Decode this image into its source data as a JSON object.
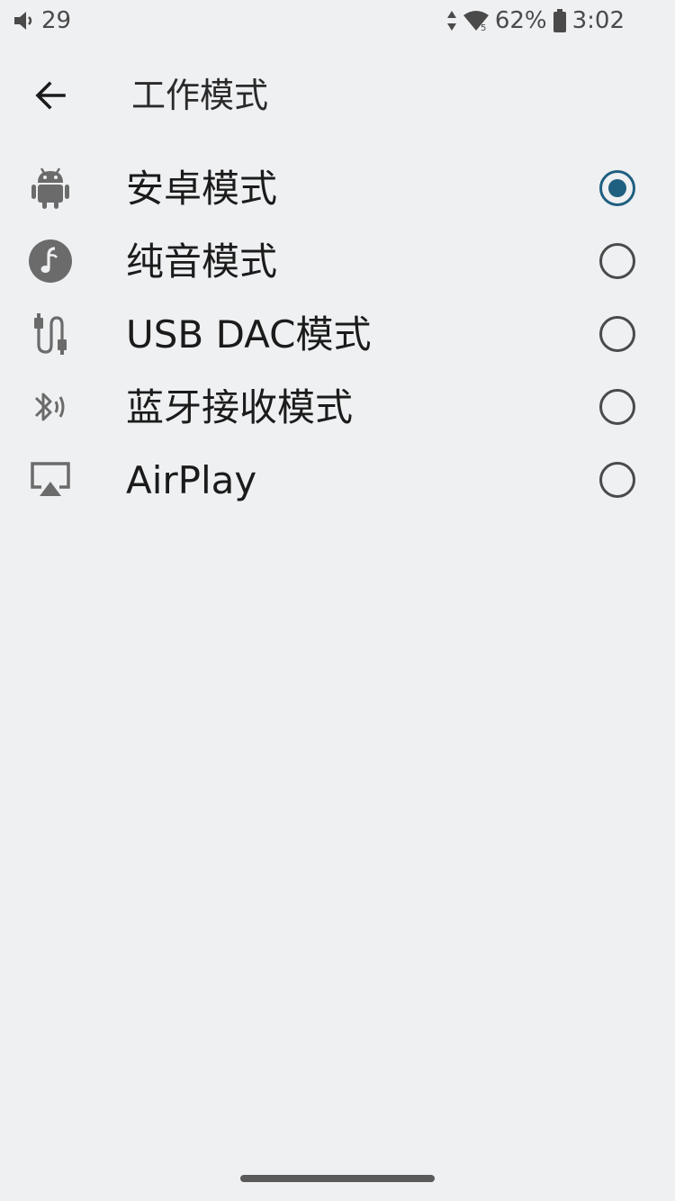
{
  "status_bar": {
    "volume": "29",
    "battery_percent": "62%",
    "time": "3:02",
    "icons": [
      "volume-icon",
      "data-arrows-icon",
      "wifi-icon",
      "battery-icon"
    ]
  },
  "header": {
    "title": "工作模式",
    "back_icon": "arrow-left-icon"
  },
  "modes": [
    {
      "label": "安卓模式",
      "icon": "android-icon",
      "selected": true
    },
    {
      "label": "纯音模式",
      "icon": "music-note-icon",
      "selected": false
    },
    {
      "label": "USB DAC模式",
      "icon": "usb-cable-icon",
      "selected": false
    },
    {
      "label": "蓝牙接收模式",
      "icon": "bluetooth-audio-icon",
      "selected": false
    },
    {
      "label": "AirPlay",
      "icon": "airplay-icon",
      "selected": false
    }
  ],
  "colors": {
    "background": "#eff0f2",
    "accent": "#1f5f80",
    "icon_gray": "#6b6b6b"
  }
}
